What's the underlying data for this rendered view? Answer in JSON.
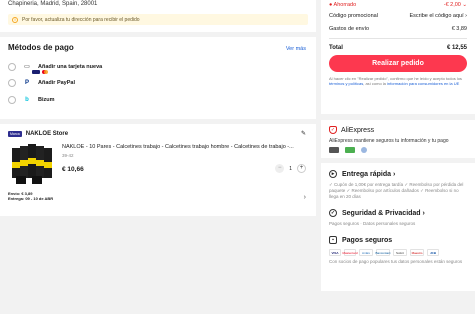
{
  "address": {
    "line": "Chapineria, Madrid, Spain, 28001",
    "warning": "Por favor, actualiza tu dirección para recibir el pedido"
  },
  "payment": {
    "title": "Métodos de pago",
    "see_more": "Ver más",
    "methods": [
      {
        "label": "Añadir una tarjeta nueva",
        "icon": "card-icon"
      },
      {
        "label": "Añadir PayPal",
        "icon": "paypal-icon"
      },
      {
        "label": "Bizum",
        "icon": "bizum-icon"
      }
    ]
  },
  "store": {
    "badge": "Marca",
    "name": "NAKLOE Store",
    "product": {
      "title": "NAKLOE - 10 Pares - Calcetines trabajo - Calcetines trabajo hombre - Calcetines de trabajo -...",
      "variant": "39-42",
      "price": "€ 10,66",
      "quantity": "1"
    },
    "shipping_cost": "Envío: € 3,89",
    "delivery": "Entrega: 09 - 10 de ABR"
  },
  "summary": {
    "saved_label": "Ahorrado",
    "saved_value": "-€ 2,00",
    "promo_label": "Código promocional",
    "promo_value": "Escribe el código aquí",
    "shipping_label": "Gastos de envío",
    "shipping_value": "€ 3,89",
    "total_label": "Total",
    "total_value": "€ 12,55",
    "order_button": "Realizar pedido",
    "legal_pre": "Al hacer clic en \"Realizar pedido\", confirmo que he leído y acepto todos los ",
    "legal_link1": "términos y políticas",
    "legal_mid": ", así como la ",
    "legal_link2": "información para consumidores en la UE"
  },
  "trust": {
    "brand": "AliExpress",
    "text": "AliExpress mantiene seguros tu información y tu pago"
  },
  "features": {
    "fast_title": "Entrega rápida",
    "fast_text": "✓ Cupón de 1,00€ por entrega tardía ✓ Reembolso por pérdida del paquete ✓ Reembolso por artículos dañados ✓ Reembolso si no llega en 20 días",
    "security_title": "Seguridad & Privacidad",
    "security_text": "Pagos seguros · Datos personales seguros",
    "secure_pay_title": "Pagos seguros",
    "secure_pay_text": "Con socios de pago populares tus datos personales están seguros",
    "pay_logos": [
      "VISA",
      "Mastercard",
      "AmEx",
      "Bancontact",
      "Sofort",
      "Maestro",
      "JCB"
    ]
  },
  "colors": {
    "accent": "#fd384f",
    "link": "#1a5fd6",
    "saved": "#e02020"
  }
}
